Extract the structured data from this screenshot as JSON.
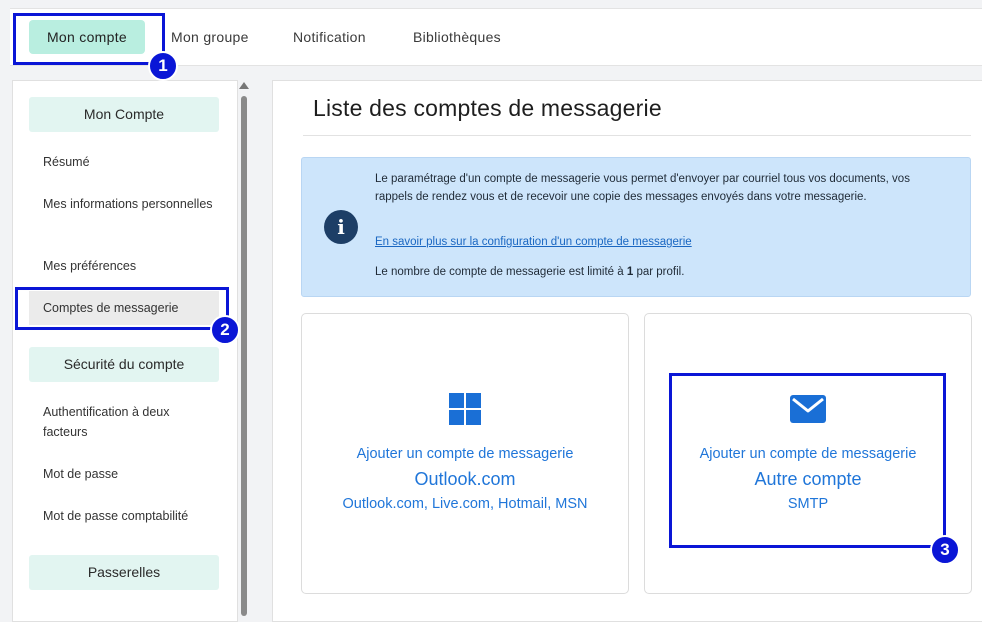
{
  "nav": {
    "tabs": [
      {
        "label": "Mon compte",
        "active": true
      },
      {
        "label": "Mon groupe"
      },
      {
        "label": "Notification"
      },
      {
        "label": "Bibliothèques"
      }
    ]
  },
  "sidebar": {
    "sections": [
      {
        "title": "Mon Compte",
        "items": [
          "Résumé",
          "Mes informations personnelles",
          "Mes préférences",
          "Comptes de messagerie"
        ]
      },
      {
        "title": "Sécurité du compte",
        "items": [
          "Authentification à deux facteurs",
          "Mot de passe",
          "Mot de passe comptabilité"
        ]
      },
      {
        "title": "Passerelles",
        "items": []
      }
    ]
  },
  "main": {
    "title": "Liste des comptes de messagerie",
    "info": {
      "text": "Le paramétrage d'un compte de messagerie vous permet d'envoyer par courriel tous vos documents, vos rappels de rendez vous et de recevoir une copie des messages envoyés dans votre messagerie.",
      "link": "En savoir plus sur la configuration d'un compte de messagerie",
      "limit_prefix": "Le nombre de compte de messagerie est limité à ",
      "limit_value": "1",
      "limit_suffix": " par profil."
    },
    "cards": [
      {
        "icon": "windows-icon",
        "line1": "Ajouter un compte de messagerie",
        "line2": "Outlook.com",
        "line3": "Outlook.com, Live.com, Hotmail, MSN"
      },
      {
        "icon": "envelope-icon",
        "line1": "Ajouter un compte de messagerie",
        "line2": "Autre compte",
        "line3": "SMTP"
      }
    ]
  },
  "annotations": [
    "1",
    "2",
    "3"
  ],
  "colors": {
    "accent": "#2076d9",
    "highlight": "#0a16d6",
    "active_tab": "#b9eee0",
    "info_bg": "#cde5fb"
  }
}
